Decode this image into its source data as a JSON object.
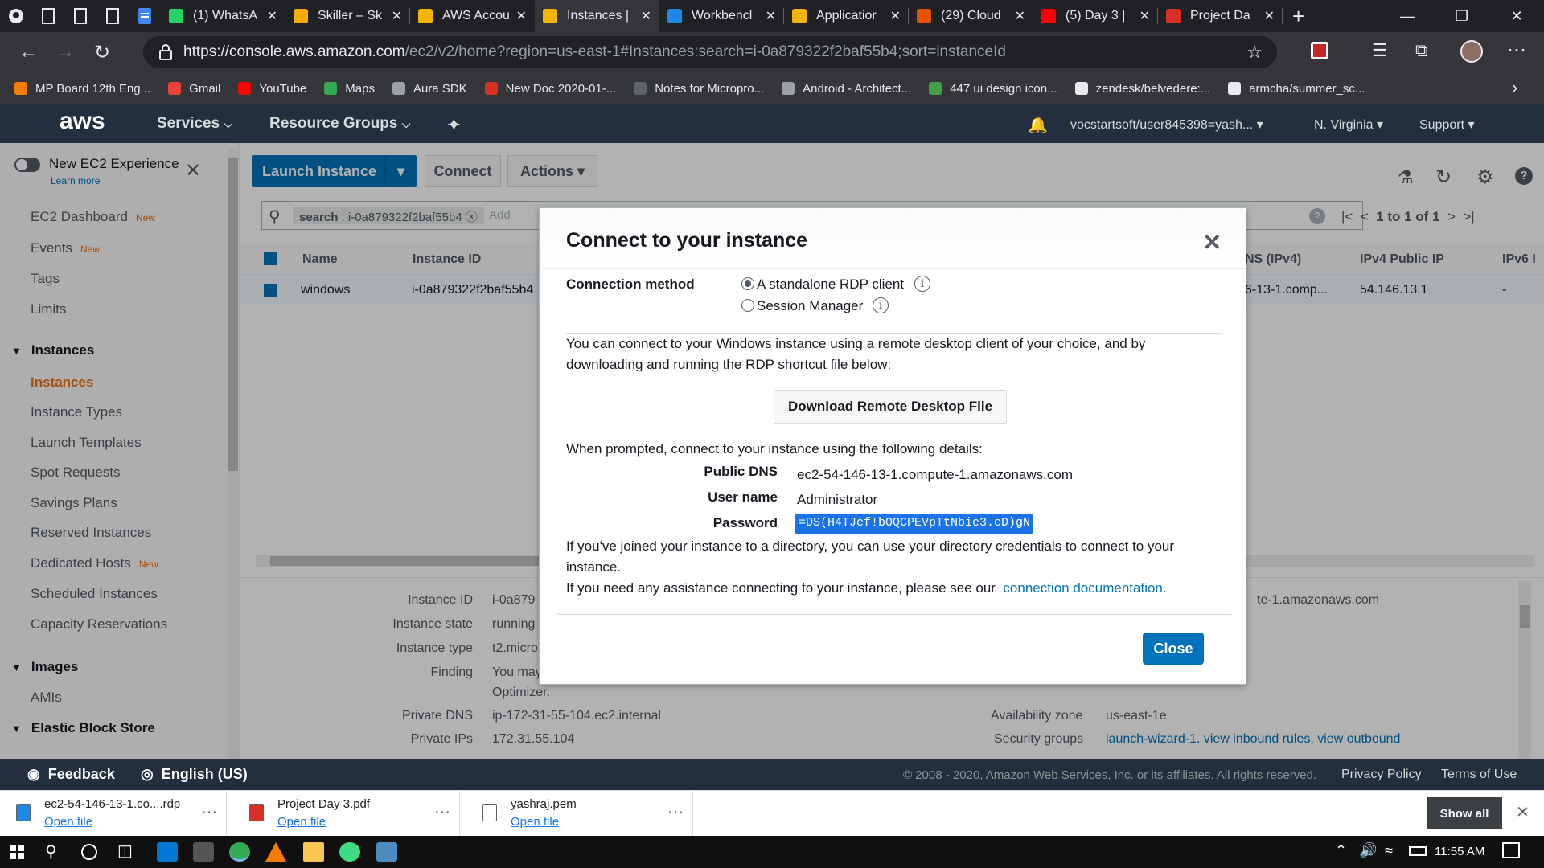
{
  "browser": {
    "tabs": [
      {
        "title": "(1) WhatsA",
        "color": "#25d366"
      },
      {
        "title": "Skiller – Sk",
        "color": "#f9ab00"
      },
      {
        "title": "AWS Accou",
        "color": "#f4b400"
      },
      {
        "title": "Instances |",
        "color": "#f4b400"
      },
      {
        "title": "Workbencl",
        "color": "#1e88e5"
      },
      {
        "title": "Applicatior",
        "color": "#f4b400"
      },
      {
        "title": "(29) Cloud",
        "color": "#e65100"
      },
      {
        "title": "(5) Day 3 |",
        "color": "#ff0000"
      },
      {
        "title": "Project Da",
        "color": "#d93025"
      }
    ],
    "url_host": "https://console.aws.amazon.com",
    "url_path": "/ec2/v2/home?region=us-east-1#Instances:search=i-0a879322f2baf55b4;sort=instanceId",
    "bookmarks": [
      {
        "label": "MP Board 12th Eng...",
        "color": "#f57c00"
      },
      {
        "label": "Gmail",
        "color": "#ea4335"
      },
      {
        "label": "YouTube",
        "color": "#ff0000"
      },
      {
        "label": "Maps",
        "color": "#34a853"
      },
      {
        "label": "Aura SDK",
        "color": "#9aa0a6"
      },
      {
        "label": "New Doc 2020-01-...",
        "color": "#d93025"
      },
      {
        "label": "Notes for Micropro...",
        "color": "#5f6368"
      },
      {
        "label": "Android - Architect...",
        "color": "#9aa0a6"
      },
      {
        "label": "447 ui design icon...",
        "color": "#43a047"
      },
      {
        "label": "zendesk/belvedere:...",
        "color": "#e8eaed"
      },
      {
        "label": "armcha/summer_sc...",
        "color": "#e8eaed"
      }
    ]
  },
  "aws_nav": {
    "logo": "aws",
    "services": "Services",
    "resource_groups": "Resource Groups",
    "account": "vocstartsoft/user845398=yash...",
    "region": "N. Virginia",
    "support": "Support"
  },
  "sidebar": {
    "new_exp": "New EC2 Experience",
    "learn_more": "Learn more",
    "new_badge": "New",
    "items": [
      {
        "label": "EC2 Dashboard",
        "new": true
      },
      {
        "label": "Events",
        "new": true
      },
      {
        "label": "Tags",
        "new": false
      },
      {
        "label": "Limits",
        "new": false
      }
    ],
    "instances_head": "Instances",
    "instances_items": [
      {
        "label": "Instances",
        "new": false,
        "active": true
      },
      {
        "label": "Instance Types",
        "new": false
      },
      {
        "label": "Launch Templates",
        "new": false
      },
      {
        "label": "Spot Requests",
        "new": false
      },
      {
        "label": "Savings Plans",
        "new": false
      },
      {
        "label": "Reserved Instances",
        "new": false
      },
      {
        "label": "Dedicated Hosts",
        "new": true
      },
      {
        "label": "Scheduled Instances",
        "new": false
      },
      {
        "label": "Capacity Reservations",
        "new": false
      }
    ],
    "images_head": "Images",
    "amis": "AMIs",
    "ebs_head": "Elastic Block Store"
  },
  "toolbar": {
    "launch": "Launch Instance",
    "connect": "Connect",
    "actions": "Actions",
    "search_token": "search",
    "search_value": "i-0a879322f2baf55b4",
    "add_filter": "Add",
    "pager": "1 to 1 of 1"
  },
  "table": {
    "headers": [
      "Name",
      "Instance ID",
      "NS (IPv4)",
      "IPv4 Public IP",
      "IPv6 I"
    ],
    "row": {
      "name": "windows",
      "id": "i-0a879322f2baf55b4",
      "dns": "6-13-1.comp...",
      "ip": "54.146.13.1",
      "ipv6": "-"
    }
  },
  "details": {
    "left": [
      {
        "label": "Instance ID",
        "value": "i-0a879"
      },
      {
        "label": "Instance state",
        "value": "running"
      },
      {
        "label": "Instance type",
        "value": "t2.micro"
      },
      {
        "label": "Finding",
        "value": "You may"
      },
      {
        "label": "",
        "value": "Optimizer."
      },
      {
        "label": "Private DNS",
        "value": "ip-172-31-55-104.ec2.internal"
      },
      {
        "label": "Private IPs",
        "value": "172.31.55.104"
      }
    ],
    "right_dns": "te-1.amazonaws.com",
    "az_label": "Availability zone",
    "az_value": "us-east-1e",
    "sg_label": "Security groups",
    "sg_links": [
      "launch-wizard-1",
      "view inbound rules",
      "view outbound"
    ]
  },
  "modal": {
    "title": "Connect to your instance",
    "method_label": "Connection method",
    "option_rdp": "A standalone RDP client",
    "option_ssm": "Session Manager",
    "intro": "You can connect to your Windows instance using a remote desktop client of your choice, and by downloading and running the RDP shortcut file below:",
    "download": "Download Remote Desktop File",
    "prompted": "When prompted, connect to your instance using the following details:",
    "dns_label": "Public DNS",
    "dns_value": "ec2-54-146-13-1.compute-1.amazonaws.com",
    "user_label": "User name",
    "user_value": "Administrator",
    "pw_label": "Password",
    "pw_value": "=DS(H4TJef!bOQCPEVpTtNbie3.cD)gN",
    "joined": "If you've joined your instance to a directory, you can use your directory credentials to connect to your instance.",
    "assist": "If you need any assistance connecting to your instance, please see our",
    "doc_link": "connection documentation",
    "period": ".",
    "close": "Close"
  },
  "aws_footer": {
    "feedback": "Feedback",
    "language": "English (US)",
    "copyright": "© 2008 - 2020, Amazon Web Services, Inc. or its affiliates. All rights reserved.",
    "privacy": "Privacy Policy",
    "terms": "Terms of Use"
  },
  "downloads": {
    "items": [
      {
        "name": "ec2-54-146-13-1.co....rdp",
        "action": "Open file"
      },
      {
        "name": "Project Day 3.pdf",
        "action": "Open file"
      },
      {
        "name": "yashraj.pem",
        "action": "Open file"
      }
    ],
    "show_all": "Show all"
  },
  "taskbar": {
    "time": "11:55 AM"
  }
}
